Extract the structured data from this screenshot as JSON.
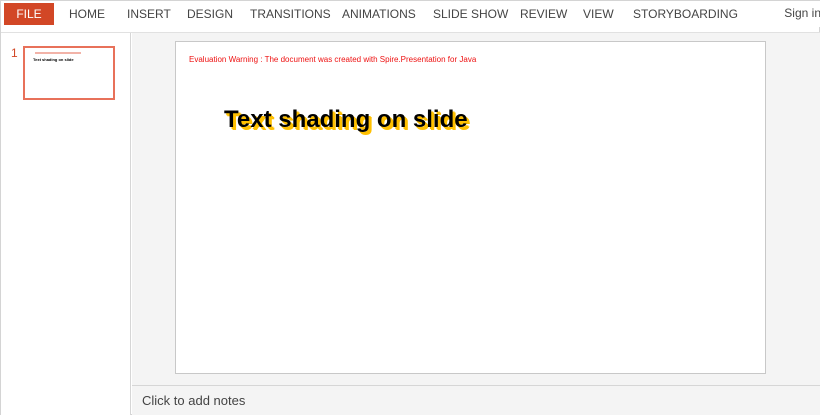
{
  "ribbon": {
    "file": "FILE",
    "tabs": [
      "HOME",
      "INSERT",
      "DESIGN",
      "TRANSITIONS",
      "ANIMATIONS",
      "SLIDE SHOW",
      "REVIEW",
      "VIEW",
      "STORYBOARDING"
    ],
    "sign_in": "Sign in"
  },
  "thumbnails": {
    "number": "1",
    "title": "Text shading on slide"
  },
  "slide": {
    "warning": "Evaluation Warning : The document was created with  Spire.Presentation for Java",
    "title": "Text shading on slide"
  },
  "notes": {
    "placeholder": "Click to add notes"
  },
  "colors": {
    "file_tab": "#d24726",
    "warning_text": "#ee1111",
    "title_shadow": "#ffc000"
  }
}
